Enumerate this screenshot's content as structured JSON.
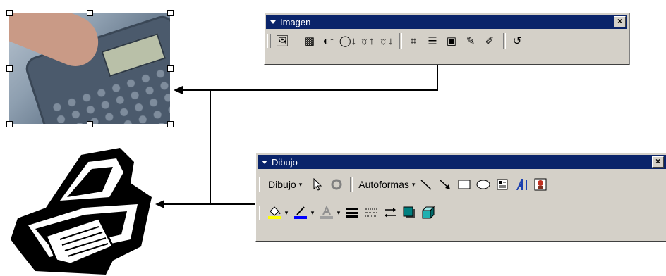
{
  "toolbar_imagen": {
    "title": "Imagen",
    "close_symbol": "×",
    "buttons": [
      {
        "name": "insert-picture-icon",
        "glyph": "🖼"
      },
      {
        "name": "color-icon",
        "glyph": "▩"
      },
      {
        "name": "more-contrast-icon",
        "glyph": "◐↑"
      },
      {
        "name": "less-contrast-icon",
        "glyph": "◯↓"
      },
      {
        "name": "more-brightness-icon",
        "glyph": "☼↑"
      },
      {
        "name": "less-brightness-icon",
        "glyph": "☼↓"
      },
      {
        "name": "crop-icon",
        "glyph": "⌗"
      },
      {
        "name": "line-style-icon",
        "glyph": "☰"
      },
      {
        "name": "text-wrapping-icon",
        "glyph": "▣"
      },
      {
        "name": "format-picture-icon",
        "glyph": "✎"
      },
      {
        "name": "set-transparent-color-icon",
        "glyph": "✐"
      },
      {
        "name": "reset-picture-icon",
        "glyph": "↺"
      }
    ]
  },
  "toolbar_dibujo": {
    "title": "Dibujo",
    "close_symbol": "×",
    "draw_menu_label": "Dibujo",
    "draw_menu_underline": "b",
    "autoshapes_label": "Autoformas",
    "autoshapes_underline": "u",
    "dropdown_symbol": "▾"
  }
}
